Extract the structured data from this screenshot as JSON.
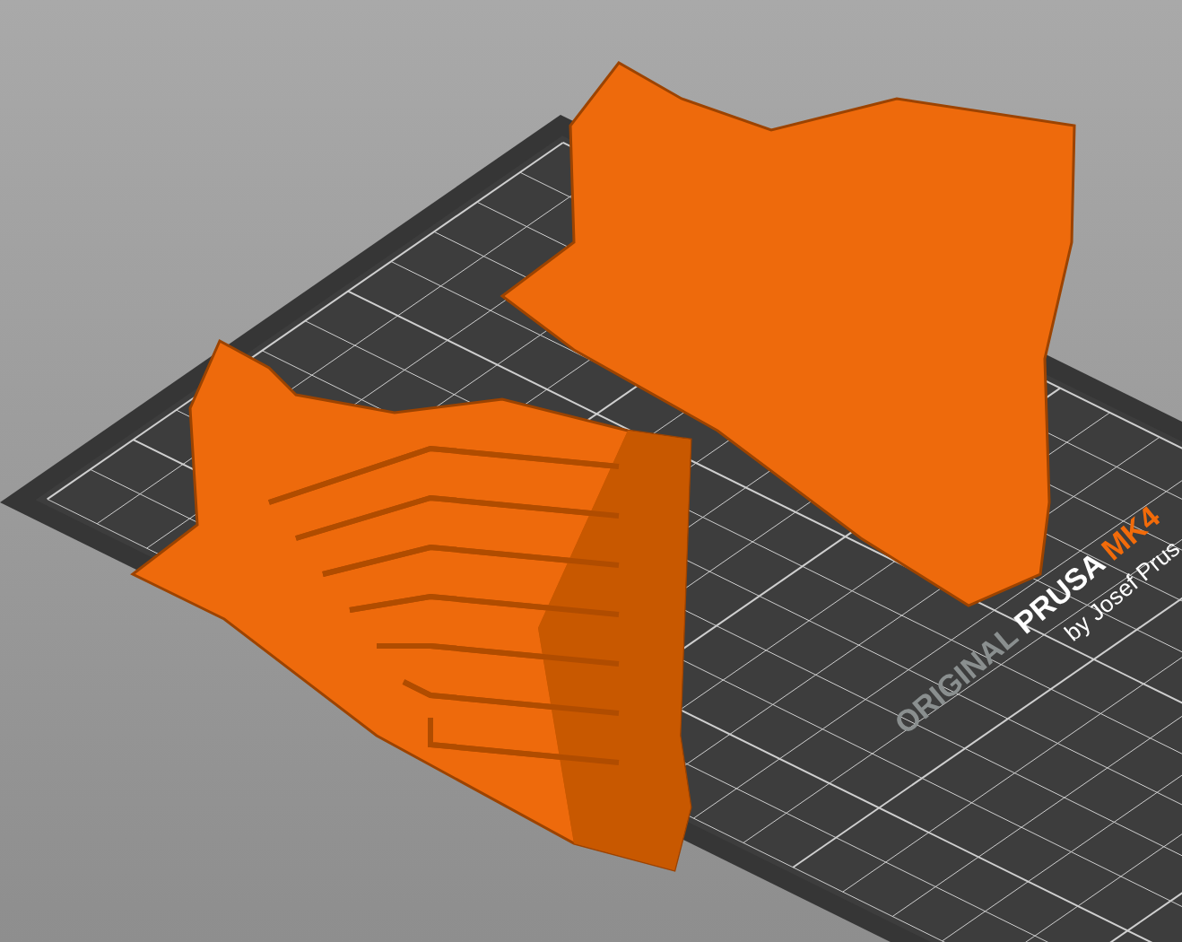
{
  "viewport": {
    "bed_logo": {
      "brand_prefix": "ORIGINAL",
      "brand": "PRUSA",
      "model": "MK4",
      "byline": "by Josef Prus"
    }
  }
}
